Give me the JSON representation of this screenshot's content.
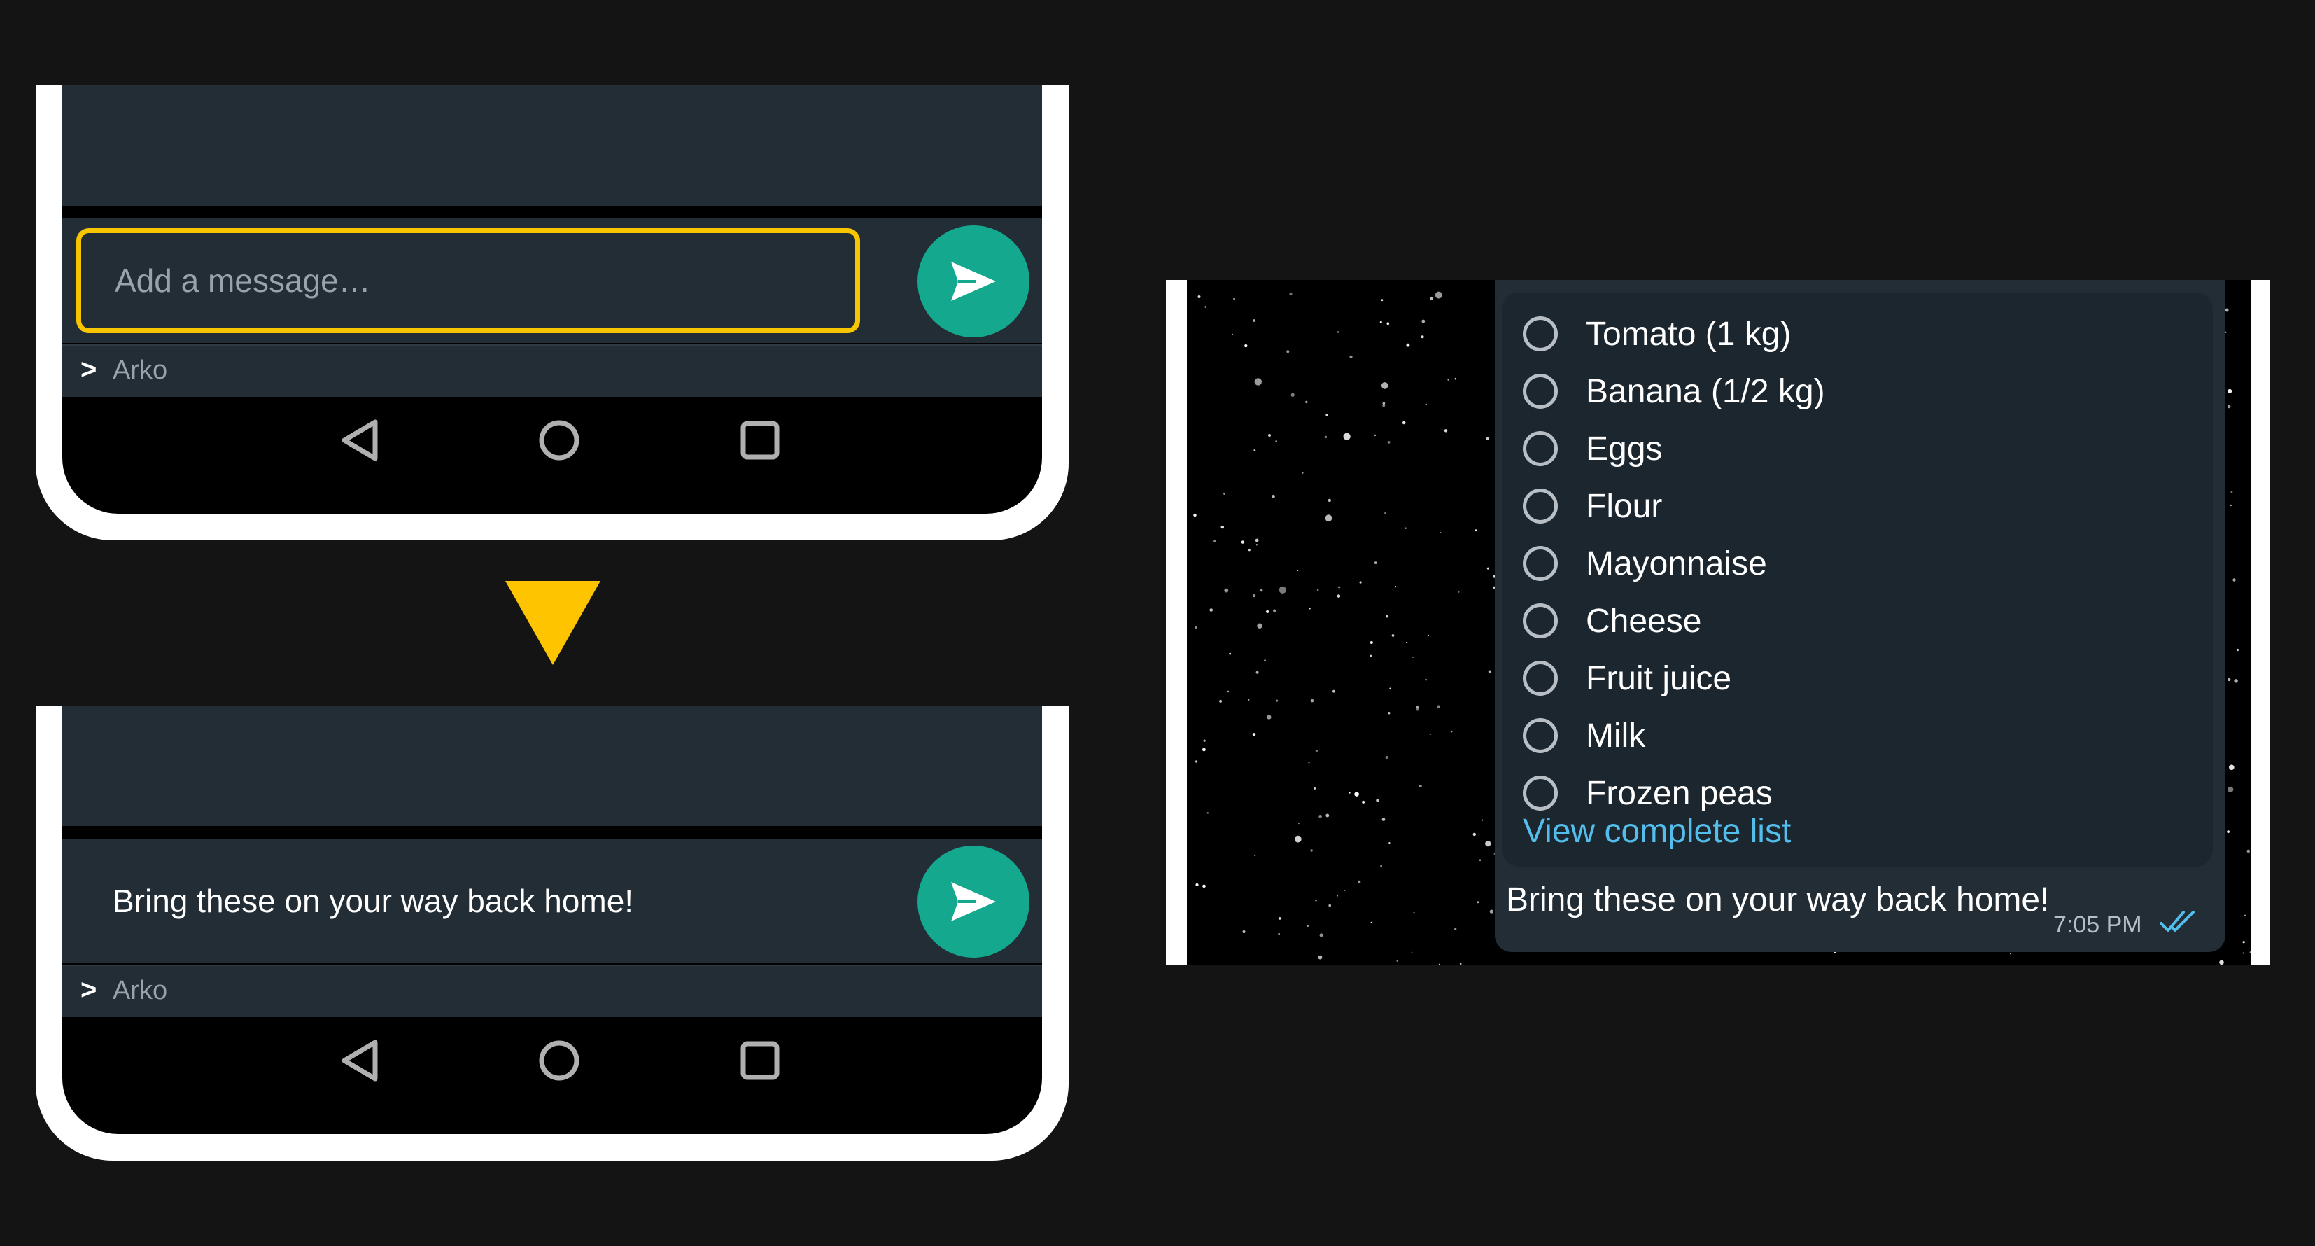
{
  "composer_before": {
    "placeholder": "Add a message…",
    "sender_chevron": ">",
    "sender_name": "Arko"
  },
  "composer_after": {
    "message": "Bring these on your way back home!",
    "sender_chevron": ">",
    "sender_name": "Arko"
  },
  "colors": {
    "accent_highlight": "#f7c600",
    "send_button": "#14a88f",
    "chat_panel": "#232d35",
    "link": "#53bdeb",
    "read_ticks": "#53bdeb"
  },
  "icons": {
    "send": "send-icon",
    "nav_back": "nav-back-icon",
    "nav_home": "nav-home-icon",
    "nav_recent": "nav-recent-icon",
    "transition": "down-arrow-icon",
    "list_item": "radio-circle-icon",
    "status": "double-check-icon"
  },
  "message_preview": {
    "items": [
      "Tomato (1 kg)",
      "Banana (1/2 kg)",
      "Eggs",
      "Flour",
      "Mayonnaise",
      "Cheese",
      "Fruit juice",
      "Milk",
      "Frozen peas"
    ],
    "view_link": "View complete list",
    "caption": "Bring these on your way back home!",
    "time": "7:05 PM"
  }
}
